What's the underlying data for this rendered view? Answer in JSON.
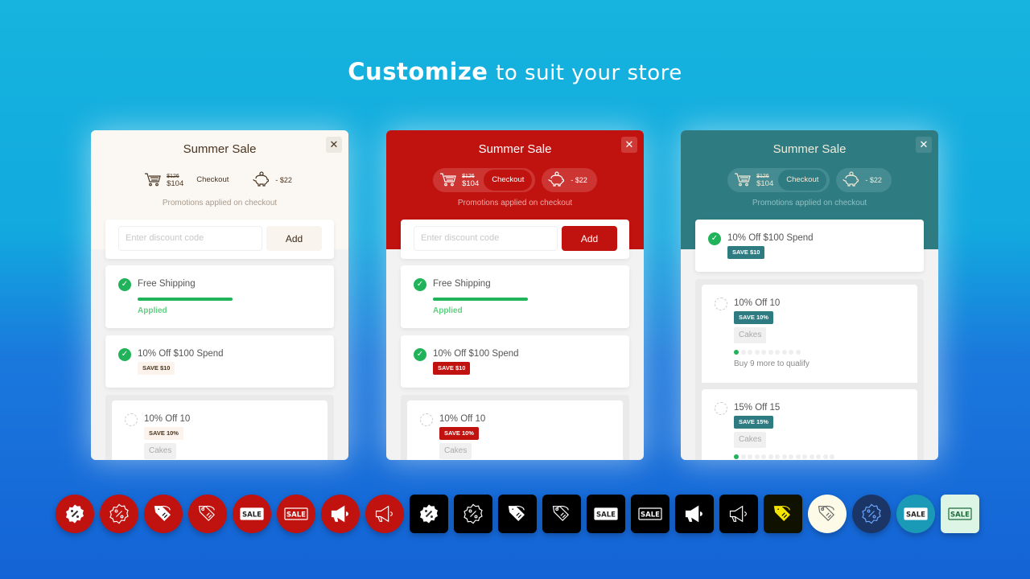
{
  "headline": {
    "bold": "Customize",
    "rest": "to suit your store"
  },
  "cards": [
    {
      "theme": {
        "header_bg": "#fbf8f4",
        "title": "#4a3520",
        "close_bg": "#ece8e2",
        "close_fg": "#4a3520",
        "pill_bg": "#fbf8f4",
        "pill_fg": "#4a3520",
        "chk_bg": "#fbf8f4",
        "promo": "#a89a8c",
        "add_bg": "#f9f4ee",
        "add_fg": "#3a2a1a",
        "badge_bg": "#fbf3ec",
        "badge_fg": "#4a3520"
      },
      "title": "Summer Sale",
      "cart": {
        "old": "$126",
        "new": "$104"
      },
      "checkout": "Checkout",
      "savings": "- $22",
      "promo_text": "Promotions applied on checkout",
      "discount": {
        "placeholder": "Enter discount code",
        "add": "Add"
      },
      "items": [
        {
          "title": "Free Shipping",
          "status": "Applied",
          "progress": 1
        },
        {
          "title": "10% Off $100 Spend",
          "badge": "SAVE $10"
        }
      ],
      "group": [
        {
          "title": "10% Off 10",
          "badge": "SAVE 10%",
          "tag": "Cakes"
        }
      ]
    },
    {
      "theme": {
        "header_bg": "#c0120f",
        "title": "#fff",
        "close_bg": "#d03a36",
        "close_fg": "#fff",
        "pill_bg": "#cd3532",
        "pill_fg": "#fff",
        "chk_bg": "#c0120f",
        "promo": "#f0a8a6",
        "add_bg": "#c0120f",
        "add_fg": "#fff",
        "badge_bg": "#c0120f",
        "badge_fg": "#fff"
      },
      "title": "Summer Sale",
      "cart": {
        "old": "$126",
        "new": "$104"
      },
      "checkout": "Checkout",
      "savings": "- $22",
      "promo_text": "Promotions applied on checkout",
      "discount": {
        "placeholder": "Enter discount code",
        "add": "Add"
      },
      "items": [
        {
          "title": "Free Shipping",
          "status": "Applied",
          "progress": 1
        },
        {
          "title": "10% Off $100 Spend",
          "badge": "SAVE $10"
        }
      ],
      "group": [
        {
          "title": "10% Off 10",
          "badge": "SAVE 10%",
          "tag": "Cakes"
        }
      ]
    },
    {
      "theme": {
        "header_bg": "#2e7b82",
        "title": "#f3ead8",
        "close_bg": "#468a90",
        "close_fg": "#fff",
        "pill_bg": "#448c92",
        "pill_fg": "#f3ead8",
        "chk_bg": "#2e7b82",
        "promo": "#8fc0c3",
        "add_bg": "#2e7b82",
        "add_fg": "#fff",
        "badge_bg": "#2e7b82",
        "badge_fg": "#fff"
      },
      "title": "Summer Sale",
      "cart": {
        "old": "$126",
        "new": "$104"
      },
      "checkout": "Checkout",
      "savings": "- $22",
      "promo_text": "Promotions applied on checkout",
      "items": [
        {
          "title": "10% Off $100 Spend",
          "badge": "SAVE $10"
        }
      ],
      "group": [
        {
          "title": "10% Off 10",
          "badge": "SAVE 10%",
          "tag": "Cakes",
          "progress": {
            "done": 1,
            "total": 10
          },
          "hint": "Buy 9 more to qualify"
        },
        {
          "title": "15% Off 15",
          "badge": "SAVE 15%",
          "tag": "Cakes",
          "progress": {
            "done": 1,
            "total": 15
          }
        }
      ]
    }
  ],
  "icon_styles": [
    {
      "name": "badge-percent-filled",
      "shape": "circle",
      "bg": "#c0120f",
      "fg": "#fff"
    },
    {
      "name": "badge-percent-outline",
      "shape": "circle",
      "bg": "#c0120f",
      "fg": "#fff"
    },
    {
      "name": "tags-filled",
      "shape": "circle",
      "bg": "#c0120f",
      "fg": "#fff"
    },
    {
      "name": "tags-outline",
      "shape": "circle",
      "bg": "#c0120f",
      "fg": "#fff"
    },
    {
      "name": "sale-filled",
      "shape": "circle",
      "bg": "#c0120f",
      "fg": "#fff"
    },
    {
      "name": "sale-outline",
      "shape": "circle",
      "bg": "#c0120f",
      "fg": "#fff"
    },
    {
      "name": "megaphone-filled",
      "shape": "circle",
      "bg": "#c0120f",
      "fg": "#fff"
    },
    {
      "name": "megaphone-outline",
      "shape": "circle",
      "bg": "#c0120f",
      "fg": "#fff"
    },
    {
      "name": "badge-percent-filled",
      "shape": "square",
      "bg": "#000",
      "fg": "#fff"
    },
    {
      "name": "badge-percent-outline",
      "shape": "square",
      "bg": "#000",
      "fg": "#fff"
    },
    {
      "name": "tags-filled",
      "shape": "square",
      "bg": "#000",
      "fg": "#fff"
    },
    {
      "name": "tags-outline",
      "shape": "square",
      "bg": "#000",
      "fg": "#fff"
    },
    {
      "name": "sale-filled",
      "shape": "square",
      "bg": "#000",
      "fg": "#fff"
    },
    {
      "name": "sale-outline",
      "shape": "square",
      "bg": "#000",
      "fg": "#fff"
    },
    {
      "name": "megaphone-filled",
      "shape": "square",
      "bg": "#000",
      "fg": "#fff"
    },
    {
      "name": "megaphone-outline",
      "shape": "square",
      "bg": "#000",
      "fg": "#fff"
    },
    {
      "name": "tags-filled",
      "shape": "square",
      "bg": "#111100",
      "fg": "#f5e400"
    },
    {
      "name": "tags-outline",
      "shape": "circle",
      "bg": "#fdfbe8",
      "fg": "#666"
    },
    {
      "name": "badge-percent-outline",
      "shape": "circle",
      "bg": "#1b3566",
      "fg": "#6aa8ff"
    },
    {
      "name": "sale-filled",
      "shape": "circle",
      "bg": "#1b9ab8",
      "fg": "#fff"
    },
    {
      "name": "sale-outline",
      "shape": "square",
      "bg": "#dcf5e4",
      "fg": "#1e6b3a"
    }
  ]
}
